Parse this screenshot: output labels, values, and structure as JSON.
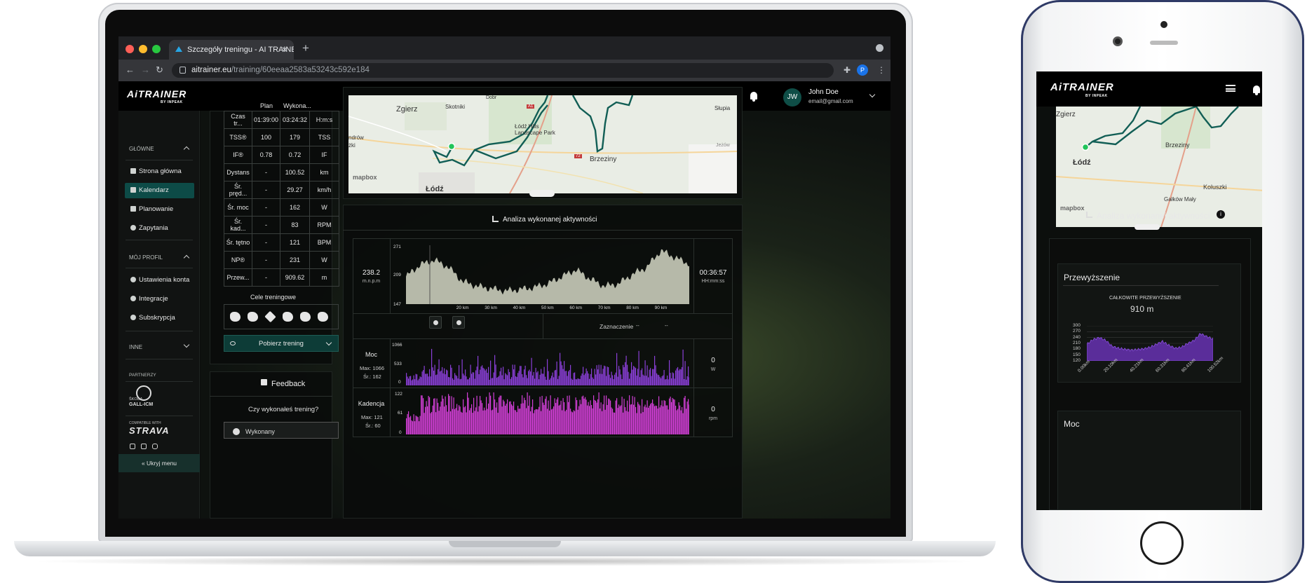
{
  "browser": {
    "tab_title": "Szczegóły treningu - AI TRAINER",
    "url_host": "aitrainer.eu",
    "url_path": "/training/60eeaa2583a53243c592e184",
    "profile_initial": "P"
  },
  "brand": {
    "logo": "AiTRAINER",
    "logo_sub": "BY INPEAK"
  },
  "user": {
    "initials": "JW",
    "name": "John Doe",
    "email": "email@gmail.com"
  },
  "sidebar": {
    "section_main": "GŁÓWNE",
    "main_items": [
      "Strona główna",
      "Kalendarz",
      "Planowanie",
      "Zapytania"
    ],
    "section_profile": "MÓJ PROFIL",
    "profile_items": [
      "Ustawienia konta",
      "Integracje",
      "Subskrypcja"
    ],
    "section_other": "INNE",
    "partners_label": "PARTNERZY",
    "partner_a": "ŠKODA",
    "partner_b": "GALL-ICM",
    "strava_small": "COMPATIBLE WITH",
    "strava": "STRAVA",
    "hide_menu": "Ukryj menu"
  },
  "summary": {
    "col_plan": "Plan",
    "col_done": "Wykona...",
    "rows": [
      {
        "label": "Czas tr...",
        "plan": "01:39:00",
        "done": "03:24:32",
        "unit": "H:m:s"
      },
      {
        "label": "TSS®",
        "plan": "100",
        "done": "179",
        "unit": "TSS"
      },
      {
        "label": "IF®",
        "plan": "0.78",
        "done": "0.72",
        "unit": "IF"
      },
      {
        "label": "Dystans",
        "plan": "-",
        "done": "100.52",
        "unit": "km"
      },
      {
        "label": "Śr. pręd...",
        "plan": "-",
        "done": "29.27",
        "unit": "km/h"
      },
      {
        "label": "Śr. moc",
        "plan": "-",
        "done": "162",
        "unit": "W"
      },
      {
        "label": "Śr. kad...",
        "plan": "-",
        "done": "83",
        "unit": "RPM"
      },
      {
        "label": "Śr. tętno",
        "plan": "-",
        "done": "121",
        "unit": "BPM"
      },
      {
        "label": "NP®",
        "plan": "-",
        "done": "231",
        "unit": "W"
      },
      {
        "label": "Przew...",
        "plan": "-",
        "done": "909.62",
        "unit": "m"
      }
    ],
    "goals_title": "Cele treningowe",
    "download_label": "Pobierz trening"
  },
  "feedback": {
    "title": "Feedback",
    "question": "Czy wykonałeś trening?",
    "done_option": "Wykonany"
  },
  "map": {
    "labels": [
      "Zgierz",
      "Skotniki",
      "Łódź Hills Landscape Park",
      "Brzeziny",
      "Łódź",
      "Słupia",
      "Jeżów",
      "ndrów",
      "żki",
      "A1",
      "72",
      "Dobr"
    ],
    "attribution": "mapbox"
  },
  "analysis": {
    "title": "Analiza wykonanej aktywności",
    "elevation": {
      "left_value": "238.2",
      "left_unit": "m.n.p.m",
      "right_value": "00:36:57",
      "right_unit": "HH:mm:ss",
      "ymax": "271",
      "ymid": "209",
      "ymin": "147"
    },
    "selection_label": "Zaznaczenie",
    "selection_a": "--",
    "selection_b": "--",
    "power": {
      "title": "Moc",
      "max": "Max: 1066",
      "avg": "Śr.: 162",
      "ymax": "1066",
      "ymid": "533",
      "ymin": "0",
      "value": "0",
      "unit": "W"
    },
    "cadence": {
      "title": "Kadencja",
      "max": "Max: 121",
      "avg": "Śr.: 60",
      "ymax": "122",
      "ymid": "61",
      "ymin": "0",
      "value": "0",
      "unit": "rpm"
    }
  },
  "chart_data": {
    "type": "area",
    "title": "",
    "xlabel": "",
    "ylabel": "",
    "ylim": [
      147,
      271
    ],
    "categories": [
      "20 km",
      "30 km",
      "40 km",
      "50 km",
      "60 km",
      "70 km",
      "80 km",
      "90 km"
    ],
    "x": [
      0,
      5,
      10,
      15,
      20,
      25,
      30,
      35,
      40,
      45,
      50,
      55,
      60,
      65,
      70,
      75,
      80,
      85,
      90,
      95,
      100
    ],
    "values": [
      205,
      230,
      240,
      225,
      195,
      185,
      180,
      175,
      178,
      182,
      190,
      205,
      220,
      200,
      185,
      190,
      210,
      225,
      260,
      245,
      232
    ]
  },
  "phone": {
    "analysis_title": "Analiza wykonanej aktywności",
    "elevation_card_title": "Przewyższenie",
    "total_elevation_label": "CAŁKOWITE PRZEWYŻSZENIE",
    "total_elevation_value": "910 m",
    "y_ticks": [
      "300",
      "270",
      "240",
      "210",
      "180",
      "150",
      "120"
    ],
    "x_ticks": [
      "0.00km",
      "20.10km",
      "40.21km",
      "60.31km",
      "80.41km",
      "100.52km"
    ],
    "next_card_title": "Moc",
    "map_labels": [
      "Zgierz",
      "Brzeziny",
      "Łódź",
      "Koluszki",
      "Gałków Mały"
    ]
  },
  "colors": {
    "accent": "#0d4b47",
    "route": "#0f5a52",
    "elevation_fill": "#b6b9a9",
    "power_fill": "#8a3fd8",
    "cadence_fill": "#d23fd6"
  }
}
